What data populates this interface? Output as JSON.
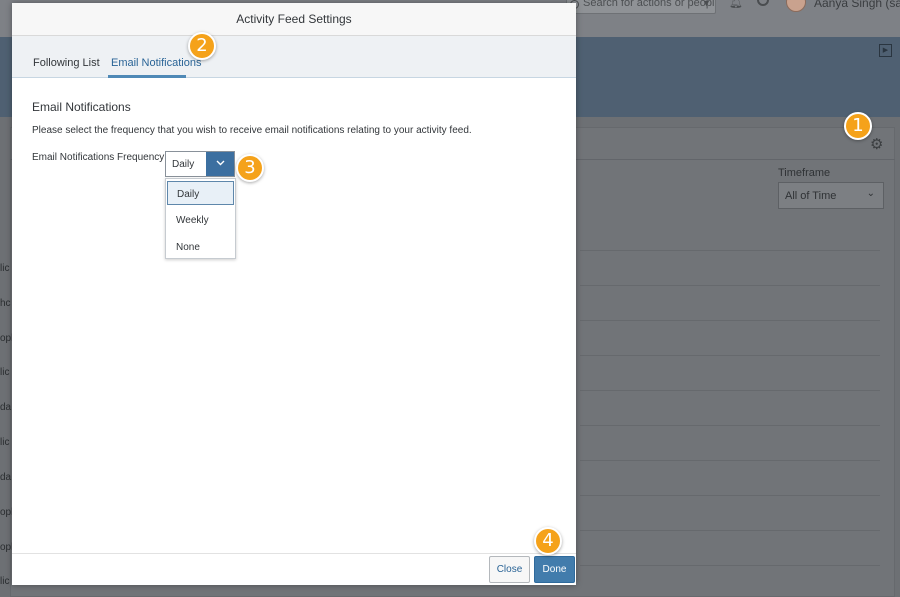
{
  "background": {
    "search_placeholder": "Search for actions or people",
    "user_name": "Aanya Singh (sadmi",
    "timeframe_label": "Timeframe",
    "timeframe_value": "All of Time",
    "row_fragments": [
      "lic",
      "hc",
      "opl",
      "lic",
      "da",
      "lic",
      "da",
      "opl",
      "opl",
      "lic"
    ]
  },
  "dialog": {
    "title": "Activity Feed Settings",
    "tabs": [
      {
        "label": "Following List",
        "active": false
      },
      {
        "label": "Email Notifications",
        "active": true
      }
    ],
    "section_title": "Email Notifications",
    "description": "Please select the frequency that you wish to receive email notifications relating to your activity feed.",
    "frequency_label": "Email Notifications Frequency",
    "frequency_value": "Daily",
    "frequency_options": [
      "Daily",
      "Weekly",
      "None"
    ],
    "buttons": {
      "close": "Close",
      "done": "Done"
    }
  },
  "step_markers": [
    "1",
    "2",
    "3",
    "4"
  ],
  "colors": {
    "accent": "#427cac",
    "marker": "#f5a21a",
    "active_tab": "#2a6496"
  }
}
